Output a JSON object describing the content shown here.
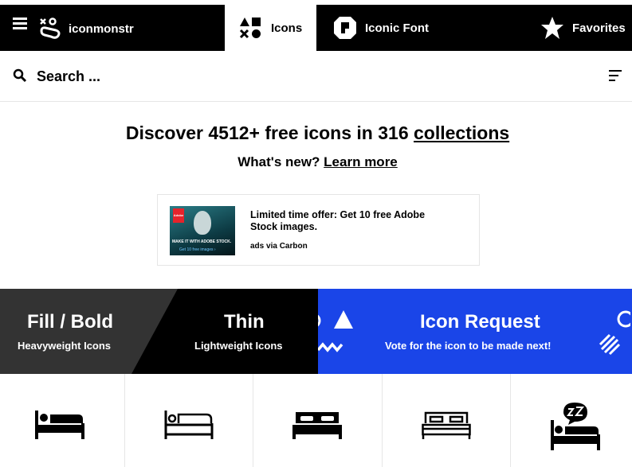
{
  "nav": {
    "brand": "iconmonstr",
    "tabs": [
      {
        "label": "Icons",
        "active": true
      },
      {
        "label": "Iconic Font",
        "active": false
      },
      {
        "label": "Favorites",
        "active": false
      }
    ]
  },
  "search": {
    "placeholder": "Search ..."
  },
  "hero": {
    "headline_prefix": "Discover 4512+ free icons in 316 ",
    "headline_link": "collections",
    "sub_prefix": "What's new? ",
    "sub_link": "Learn more"
  },
  "ad": {
    "image_logo": "Adobe",
    "image_tagline": "MAKE IT WITH ADOBE STOCK.",
    "image_cta": "Get 10 free images ›",
    "text": "Limited time offer: Get 10 free Adobe Stock images.",
    "via": "ads via Carbon"
  },
  "banners": [
    {
      "title": "Fill / Bold",
      "subtitle": "Heavyweight Icons"
    },
    {
      "title": "Thin",
      "subtitle": "Lightweight Icons"
    },
    {
      "title": "Icon Request",
      "subtitle": "Vote for the icon to be made next!"
    }
  ],
  "colors": {
    "topbar": "#000000",
    "request_banner": "#1a45e8",
    "fill_banner": "#333333"
  },
  "icons": [
    "bed-fill-icon",
    "bed-thin-icon",
    "double-bed-fill-icon",
    "double-bed-thin-icon",
    "sleep-zz-icon"
  ]
}
